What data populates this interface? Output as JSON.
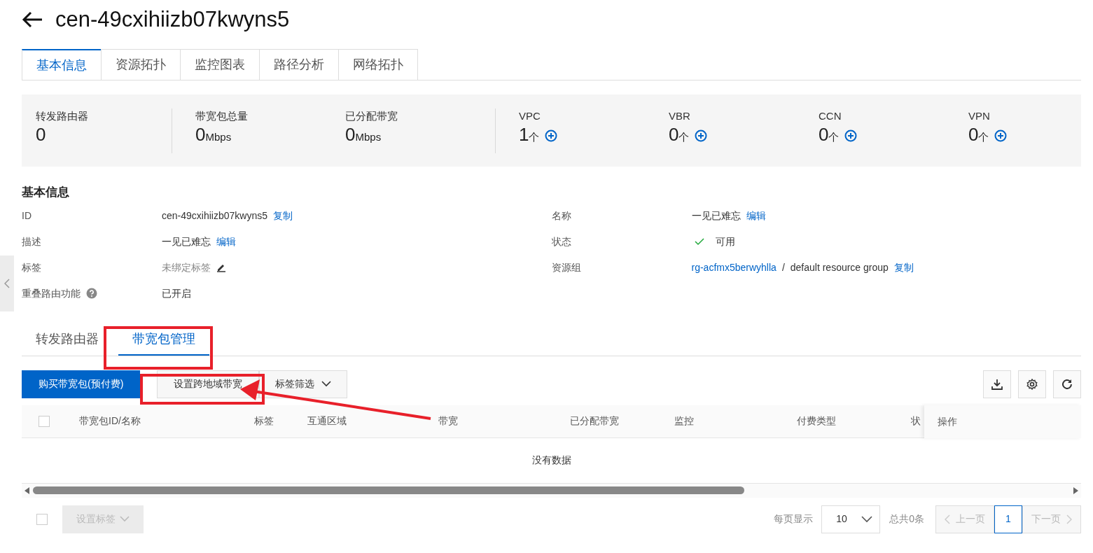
{
  "header": {
    "title": "cen-49cxihiizb07kwyns5"
  },
  "tabs": [
    {
      "label": "基本信息",
      "selected": true
    },
    {
      "label": "资源拓扑",
      "selected": false
    },
    {
      "label": "监控图表",
      "selected": false
    },
    {
      "label": "路径分析",
      "selected": false
    },
    {
      "label": "网络拓扑",
      "selected": false
    }
  ],
  "stat_groups": [
    {
      "items": [
        {
          "label": "转发路由器",
          "value": "0",
          "addable": false
        }
      ]
    },
    {
      "items": [
        {
          "label": "带宽包总量",
          "value": "0",
          "unit": "Mbps",
          "addable": false
        },
        {
          "label": "已分配带宽",
          "value": "0",
          "unit": "Mbps",
          "addable": false
        }
      ]
    },
    {
      "items": [
        {
          "label": "VPC",
          "value": "1",
          "unit": "个",
          "addable": true
        },
        {
          "label": "VBR",
          "value": "0",
          "unit": "个",
          "addable": true
        },
        {
          "label": "CCN",
          "value": "0",
          "unit": "个",
          "addable": true
        },
        {
          "label": "VPN",
          "value": "0",
          "unit": "个",
          "addable": true
        }
      ]
    }
  ],
  "basic_info": {
    "heading": "基本信息",
    "left": [
      {
        "label": "ID",
        "parts": [
          {
            "kind": "text",
            "text": "cen-49cxihiizb07kwyns5"
          },
          {
            "kind": "link",
            "text": "复制"
          }
        ]
      },
      {
        "label": "描述",
        "parts": [
          {
            "kind": "text",
            "text": "一见已难忘"
          },
          {
            "kind": "link",
            "text": "编辑"
          }
        ]
      },
      {
        "label": "标签",
        "parts": [
          {
            "kind": "muted",
            "text": "未绑定标签"
          },
          {
            "kind": "edit-icon"
          }
        ]
      },
      {
        "label": "重叠路由功能",
        "help": true,
        "parts": [
          {
            "kind": "text",
            "text": "已开启"
          }
        ]
      }
    ],
    "right": [
      {
        "label": "名称",
        "parts": [
          {
            "kind": "text",
            "text": "一见已难忘"
          },
          {
            "kind": "link",
            "text": "编辑"
          }
        ]
      },
      {
        "label": "状态",
        "parts": [
          {
            "kind": "check-icon"
          },
          {
            "kind": "text",
            "text": "可用"
          }
        ]
      },
      {
        "label": "资源组",
        "parts": [
          {
            "kind": "link",
            "text": "rg-acfmx5berwyhlla"
          },
          {
            "kind": "separator",
            "text": "/"
          },
          {
            "kind": "text",
            "text": "default resource group"
          },
          {
            "kind": "link",
            "text": "复制"
          }
        ]
      }
    ]
  },
  "sub_tabs": [
    {
      "label": "转发路由器",
      "selected": false
    },
    {
      "label": "带宽包管理",
      "selected": true
    }
  ],
  "toolbar": {
    "buttons": [
      {
        "label": "购买带宽包(预付费)",
        "kind": "primary"
      },
      {
        "label": "设置跨地域带宽",
        "kind": "default"
      },
      {
        "label": "标签筛选",
        "kind": "dropdown"
      }
    ],
    "icon_buttons": [
      {
        "kind": "download"
      },
      {
        "kind": "settings"
      },
      {
        "kind": "refresh"
      }
    ]
  },
  "table": {
    "checked": false,
    "columns": [
      "带宽包ID/名称",
      "标签",
      "互通区域",
      "带宽",
      "已分配带宽",
      "监控",
      "付费类型",
      "状"
    ],
    "fixed_column": "操作",
    "empty_text": "没有数据"
  },
  "footer": {
    "checked": false,
    "batch_button": {
      "label": "设置标签",
      "disabled": true
    },
    "page_size_label": "每页显示",
    "page_size": "10",
    "total": "总共0条",
    "prev": {
      "label": "上一页",
      "disabled": true
    },
    "pages": [
      {
        "label": "1",
        "selected": true
      }
    ],
    "next": {
      "label": "下一页",
      "disabled": true
    }
  },
  "annotations": [
    {
      "kind": "frame"
    },
    {
      "kind": "frame"
    },
    {
      "kind": "arrow"
    }
  ]
}
